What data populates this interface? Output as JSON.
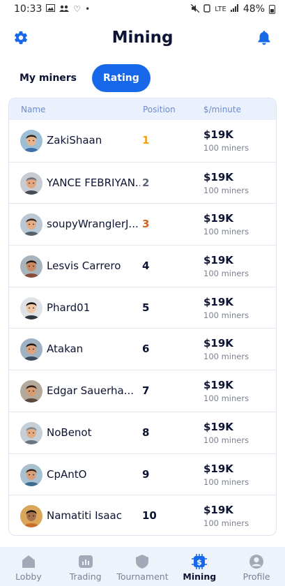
{
  "status_bar": {
    "time": "10:33",
    "dot": "•",
    "network": "LTE",
    "battery": "48%"
  },
  "header": {
    "title": "Mining"
  },
  "tabs": [
    {
      "label": "My miners",
      "active": false
    },
    {
      "label": "Rating",
      "active": true
    }
  ],
  "table": {
    "headers": {
      "name": "Name",
      "position": "Position",
      "rate": "$/minute"
    },
    "rows": [
      {
        "name": "ZakiShaan",
        "position": "1",
        "rate": "$19K",
        "miners": "100 miners",
        "pos_color": "#f2a11b"
      },
      {
        "name": "YANCE FEBRIYAN...",
        "position": "2",
        "rate": "$19K",
        "miners": "100 miners",
        "pos_color": "#5f6677"
      },
      {
        "name": "soupyWranglerJ...",
        "position": "3",
        "rate": "$19K",
        "miners": "100 miners",
        "pos_color": "#d4631a"
      },
      {
        "name": "Lesvis Carrero",
        "position": "4",
        "rate": "$19K",
        "miners": "100 miners",
        "pos_color": "#0d1333"
      },
      {
        "name": "Phard01",
        "position": "5",
        "rate": "$19K",
        "miners": "100 miners",
        "pos_color": "#0d1333"
      },
      {
        "name": "Atakan",
        "position": "6",
        "rate": "$19K",
        "miners": "100 miners",
        "pos_color": "#0d1333"
      },
      {
        "name": "Edgar Sauerha...",
        "position": "7",
        "rate": "$19K",
        "miners": "100 miners",
        "pos_color": "#0d1333"
      },
      {
        "name": "NoBenot",
        "position": "8",
        "rate": "$19K",
        "miners": "100 miners",
        "pos_color": "#0d1333"
      },
      {
        "name": "CpAntO",
        "position": "9",
        "rate": "$19K",
        "miners": "100 miners",
        "pos_color": "#0d1333"
      },
      {
        "name": "Namatiti Isaac",
        "position": "10",
        "rate": "$19K",
        "miners": "100 miners",
        "pos_color": "#0d1333"
      }
    ]
  },
  "bottom_nav": [
    {
      "label": "Lobby",
      "icon": "lobby-icon",
      "active": false
    },
    {
      "label": "Trading",
      "icon": "trading-icon",
      "active": false
    },
    {
      "label": "Tournament",
      "icon": "tournament-icon",
      "active": false
    },
    {
      "label": "Mining",
      "icon": "mining-icon",
      "active": true
    },
    {
      "label": "Profile",
      "icon": "profile-icon",
      "active": false
    }
  ],
  "colors": {
    "accent": "#1668e8",
    "gold": "#f2a11b",
    "bronze": "#d4631a",
    "silver": "#5f6677"
  }
}
